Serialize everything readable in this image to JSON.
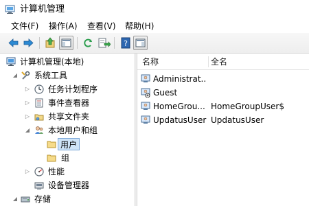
{
  "window": {
    "title": "计算机管理",
    "app_icon": "computer-management-icon"
  },
  "menu": {
    "items": [
      {
        "label": "文件(F)"
      },
      {
        "label": "操作(A)"
      },
      {
        "label": "查看(V)"
      },
      {
        "label": "帮助(H)"
      }
    ]
  },
  "toolbar": {
    "buttons": [
      {
        "icon": "back-arrow-icon"
      },
      {
        "icon": "forward-arrow-icon"
      },
      {
        "icon": "up-level-icon"
      },
      {
        "icon": "show-hide-console-tree-icon",
        "selected": true
      },
      {
        "icon": "refresh-icon"
      },
      {
        "icon": "export-list-icon"
      },
      {
        "icon": "help-icon"
      },
      {
        "icon": "show-hide-action-pane-icon",
        "selected": true
      }
    ]
  },
  "tree": {
    "items": [
      {
        "label": "计算机管理(本地)",
        "icon": "computer-icon"
      },
      {
        "label": "系统工具",
        "icon": "tools-icon"
      },
      {
        "label": "任务计划程序",
        "icon": "clock-icon"
      },
      {
        "label": "事件查看器",
        "icon": "event-viewer-icon"
      },
      {
        "label": "共享文件夹",
        "icon": "shared-folder-icon"
      },
      {
        "label": "本地用户和组",
        "icon": "users-icon"
      },
      {
        "label": "用户",
        "icon": "folder-icon",
        "selected": true
      },
      {
        "label": "组",
        "icon": "folder-icon"
      },
      {
        "label": "性能",
        "icon": "performance-icon"
      },
      {
        "label": "设备管理器",
        "icon": "device-manager-icon"
      },
      {
        "label": "存储",
        "icon": "storage-icon"
      }
    ]
  },
  "list": {
    "columns": [
      {
        "label": "名称"
      },
      {
        "label": "全名"
      }
    ],
    "rows": [
      {
        "name": "Administrat...",
        "full_name": "",
        "icon": "user-icon"
      },
      {
        "name": "Guest",
        "full_name": "",
        "icon": "disabled-user-icon"
      },
      {
        "name": "HomeGrou...",
        "full_name": "HomeGroupUser$",
        "icon": "user-icon"
      },
      {
        "name": "UpdatusUser",
        "full_name": "UpdatusUser",
        "icon": "user-icon"
      }
    ]
  }
}
